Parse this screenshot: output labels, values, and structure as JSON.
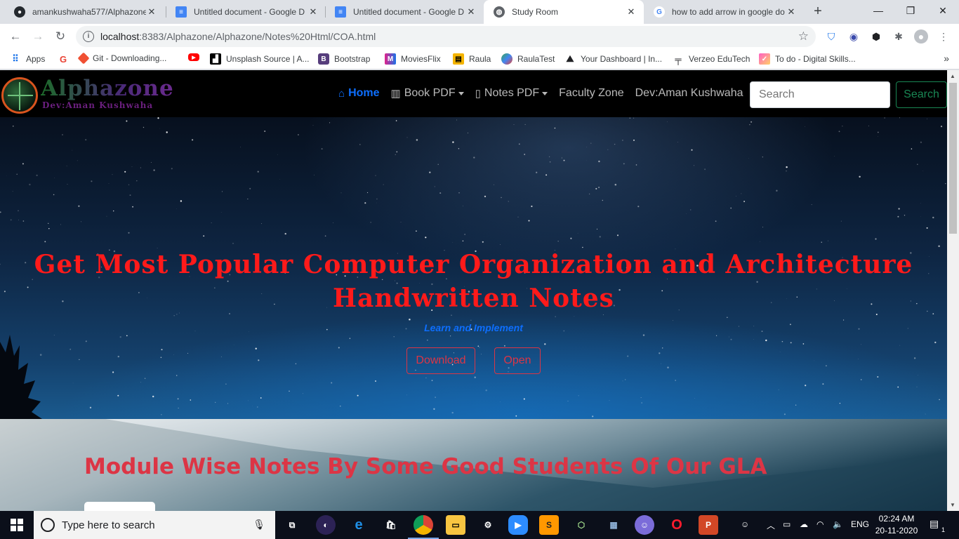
{
  "tabs": [
    {
      "title": "amankushwaha577/Alphazone",
      "icon": "github-icon"
    },
    {
      "title": "Untitled document - Google D",
      "icon": "google-docs-icon"
    },
    {
      "title": "Untitled document - Google D",
      "icon": "google-docs-icon"
    },
    {
      "title": "Study Room",
      "icon": "globe-icon"
    },
    {
      "title": "how to add arrow in google do",
      "icon": "google-icon"
    }
  ],
  "toolbar": {
    "url_host": "localhost",
    "url_rest": ":8383/Alphazone/Alphazone/Notes%20Html/COA.html"
  },
  "bookmarks": [
    {
      "label": "Apps",
      "icon": "apps-grid-icon"
    },
    {
      "label": "",
      "icon": "google-icon"
    },
    {
      "label": "Git - Downloading...",
      "icon": "git-icon"
    },
    {
      "label": "",
      "icon": "youtube-icon"
    },
    {
      "label": "Unsplash Source | A...",
      "icon": "unsplash-icon"
    },
    {
      "label": "Bootstrap",
      "icon": "bootstrap-icon"
    },
    {
      "label": "MoviesFlix",
      "icon": "moviesflix-icon"
    },
    {
      "label": "Raula",
      "icon": "raula-icon"
    },
    {
      "label": "RaulaTest",
      "icon": "raulatest-icon"
    },
    {
      "label": "Your Dashboard | In...",
      "icon": "dashboard-icon"
    },
    {
      "label": "Verzeo EduTech",
      "icon": "verzeo-icon"
    },
    {
      "label": "To do - Digital Skills...",
      "icon": "todo-icon"
    }
  ],
  "site": {
    "logo_name": "Alphazone",
    "logo_dev": "Dev:Aman Kushwaha",
    "nav": {
      "home": "Home",
      "book_pdf": "Book PDF",
      "notes_pdf": "Notes PDF",
      "faculty_zone": "Faculty Zone",
      "dev": "Dev:Aman Kushwaha"
    },
    "search_placeholder": "Search",
    "search_button": "Search",
    "hero": {
      "title_line1": "Get Most Popular Computer Organization and Architecture",
      "title_line2": "Handwritten Notes",
      "subtitle": "Learn and Implement",
      "download": "Download",
      "open": "Open"
    },
    "section_title": "Module Wise Notes By Some Good Students Of Our GLA"
  },
  "taskbar": {
    "search_placeholder": "Type here to search",
    "lang": "ENG",
    "time": "02:24 AM",
    "date": "20-11-2020",
    "notifications": "1"
  },
  "colors": {
    "hero_title": "#ff1a1a",
    "nav_active": "#0d6efd",
    "outline_danger": "#dc3545",
    "outline_success": "#198754"
  }
}
